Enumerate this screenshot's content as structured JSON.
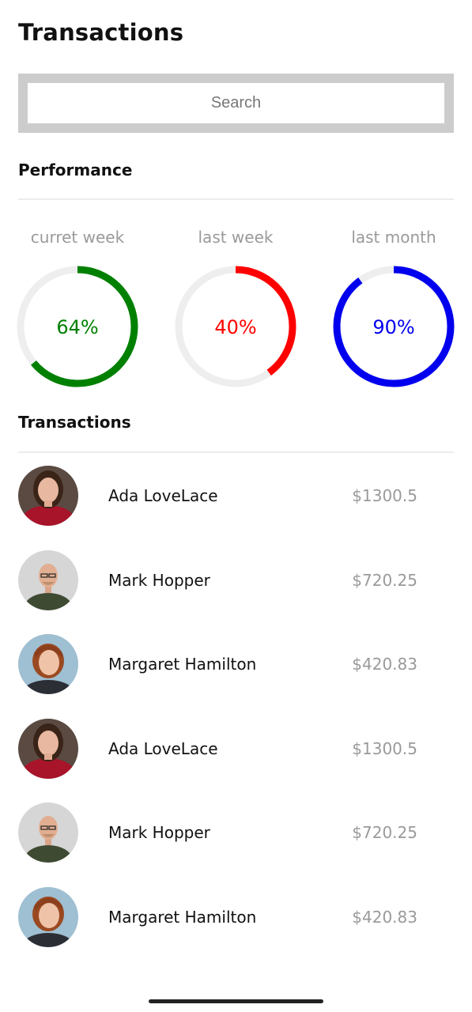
{
  "header": {
    "title": "Transactions"
  },
  "search": {
    "placeholder": "Search",
    "value": ""
  },
  "performance": {
    "title": "Performance",
    "gauges": [
      {
        "label": "curret week",
        "value_text": "64%",
        "percent": 64,
        "color": "#008000"
      },
      {
        "label": "last week",
        "value_text": "40%",
        "percent": 40,
        "color": "#ff0000"
      },
      {
        "label": "last month",
        "value_text": "90%",
        "percent": 90,
        "color": "#0000ee"
      }
    ]
  },
  "transactions": {
    "title": "Transactions",
    "items": [
      {
        "name": "Ada LoveLace",
        "amount": "$1300.5",
        "avatar": "woman-red-sweater"
      },
      {
        "name": "Mark Hopper",
        "amount": "$720.25",
        "avatar": "bald-man-glasses"
      },
      {
        "name": "Margaret Hamilton",
        "amount": "$420.83",
        "avatar": "woman-red-hair"
      },
      {
        "name": "Ada LoveLace",
        "amount": "$1300.5",
        "avatar": "woman-red-sweater"
      },
      {
        "name": "Mark Hopper",
        "amount": "$720.25",
        "avatar": "bald-man-glasses"
      },
      {
        "name": "Margaret Hamilton",
        "amount": "$420.83",
        "avatar": "woman-red-hair"
      }
    ]
  },
  "colors": {
    "track": "#eeeeee",
    "muted_text": "#9a9a9a",
    "search_frame": "#cccccc"
  }
}
